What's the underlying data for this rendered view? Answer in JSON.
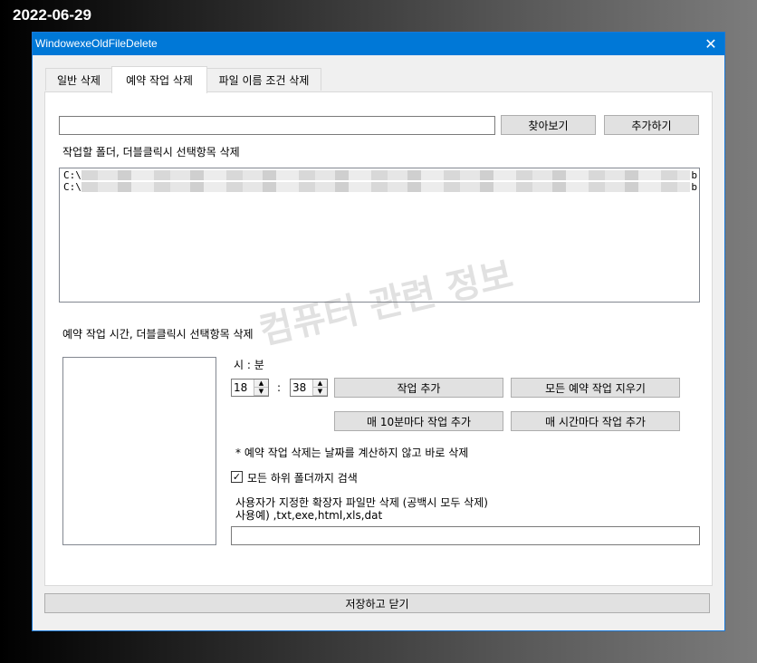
{
  "date_stamp": "2022-06-29",
  "window": {
    "title": "WindowexeOldFileDelete",
    "close_glyph": "✕"
  },
  "tabs": [
    {
      "label": "일반 삭제",
      "active": false
    },
    {
      "label": "예약 작업 삭제",
      "active": true
    },
    {
      "label": "파일 이름 조건 삭제",
      "active": false
    }
  ],
  "folder": {
    "path_value": "",
    "browse_label": "찾아보기",
    "add_label": "추가하기",
    "list_caption": "작업할 폴더, 더블클릭시 선택항목 삭제",
    "items": [
      {
        "prefix": "C:\\",
        "suffix": "b"
      },
      {
        "prefix": "C:\\",
        "suffix": "b"
      }
    ]
  },
  "schedule": {
    "caption": "예약 작업 시간, 더블클릭시 선택항목 삭제",
    "time_label": "시 : 분",
    "hour": "18",
    "separator": ":",
    "minute": "38",
    "add_job_label": "작업 추가",
    "clear_all_label": "모든 예약 작업 지우기",
    "every_10min_label": "매 10분마다 작업 추가",
    "every_hour_label": "매 시간마다 작업 추가",
    "note": "* 예약 작업 삭제는 날짜를 계산하지 않고 바로 삭제",
    "subfolders_label": "모든 하위 폴더까지 검색",
    "subfolders_checked": true,
    "ext_caption_line1": "사용자가 지정한 확장자 파일만 삭제 (공백시 모두 삭제)",
    "ext_caption_line2": "사용예) ,txt,exe,html,xls,dat",
    "ext_value": ""
  },
  "watermark": "컴퓨터 관련 정보",
  "footer": {
    "save_close_label": "저장하고 닫기"
  }
}
